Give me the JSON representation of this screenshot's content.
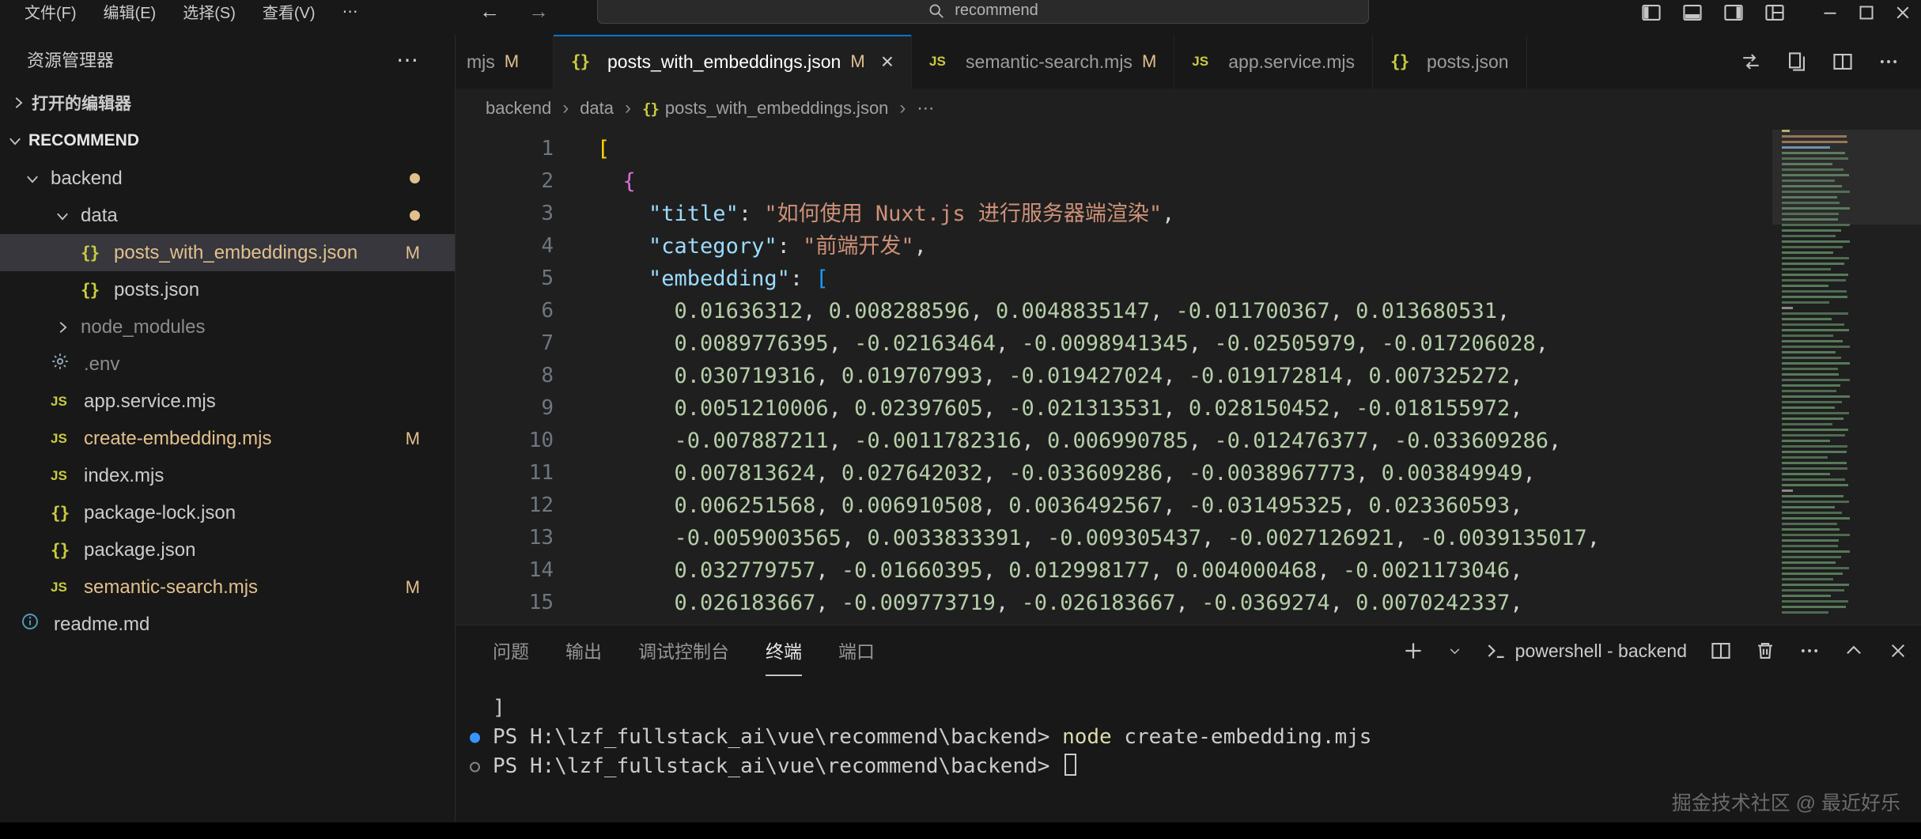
{
  "titlebar": {
    "menu_items": [
      "文件(F)",
      "编辑(E)",
      "选择(S)",
      "查看(V)",
      "⋯"
    ],
    "back_icon": "←",
    "forward_icon": "→",
    "search_value": "recommend",
    "layout_icons": [
      "toggle-primary-sidebar-icon",
      "toggle-panel-icon",
      "toggle-secondary-sidebar-icon",
      "customize-layout-icon"
    ],
    "window_controls": [
      "minimize-icon",
      "maximize-icon",
      "close-icon"
    ]
  },
  "sidebar": {
    "title": "资源管理器",
    "more_icon": "⋯",
    "open_editors_label": "打开的编辑器",
    "section_label": "RECOMMEND",
    "tree": [
      {
        "label": "backend",
        "type": "folder",
        "expanded": true,
        "indent": 0,
        "badge": "dot"
      },
      {
        "label": "data",
        "type": "folder",
        "expanded": true,
        "indent": 1,
        "badge": "dot"
      },
      {
        "label": "posts_with_embeddings.json",
        "type": "json",
        "indent": 2,
        "badge": "M",
        "selected": true,
        "modified": true
      },
      {
        "label": "posts.json",
        "type": "json",
        "indent": 2
      },
      {
        "label": "node_modules",
        "type": "folder",
        "expanded": false,
        "indent": 1,
        "dim": true
      },
      {
        "label": ".env",
        "type": "gear",
        "indent": 1,
        "dim": true
      },
      {
        "label": "app.service.mjs",
        "type": "js",
        "indent": 1
      },
      {
        "label": "create-embedding.mjs",
        "type": "js",
        "indent": 1,
        "badge": "M",
        "modified": true
      },
      {
        "label": "index.mjs",
        "type": "js",
        "indent": 1
      },
      {
        "label": "package-lock.json",
        "type": "json",
        "indent": 1
      },
      {
        "label": "package.json",
        "type": "json",
        "indent": 1
      },
      {
        "label": "semantic-search.mjs",
        "type": "js",
        "indent": 1,
        "badge": "M",
        "modified": true
      },
      {
        "label": "readme.md",
        "type": "info",
        "indent": 0
      }
    ]
  },
  "tabs": [
    {
      "label": "mjs",
      "icon": null,
      "badge": "M",
      "partial": true
    },
    {
      "label": "posts_with_embeddings.json",
      "icon": "json",
      "badge": "M",
      "active": true,
      "close": true
    },
    {
      "label": "semantic-search.mjs",
      "icon": "js",
      "badge": "M"
    },
    {
      "label": "app.service.mjs",
      "icon": "js"
    },
    {
      "label": "posts.json",
      "icon": "json"
    }
  ],
  "editor_actions": [
    "compare-changes-icon",
    "open-changes-icon",
    "split-editor-icon",
    "more-actions-icon"
  ],
  "breadcrumb": [
    {
      "label": "backend"
    },
    {
      "label": "data"
    },
    {
      "label": "posts_with_embeddings.json",
      "icon": "json"
    },
    {
      "label": "⋯"
    }
  ],
  "editor": {
    "lines": [
      {
        "n": 1,
        "tokens": [
          {
            "t": "[",
            "c": "b1"
          }
        ]
      },
      {
        "n": 2,
        "tokens": [
          {
            "t": "  ",
            "c": "p"
          },
          {
            "t": "{",
            "c": "b2"
          }
        ]
      },
      {
        "n": 3,
        "tokens": [
          {
            "t": "    ",
            "c": "p"
          },
          {
            "t": "\"title\"",
            "c": "k"
          },
          {
            "t": ": ",
            "c": "p"
          },
          {
            "t": "\"如何使用 Nuxt.js 进行服务器端渲染\"",
            "c": "s"
          },
          {
            "t": ",",
            "c": "p"
          }
        ]
      },
      {
        "n": 4,
        "tokens": [
          {
            "t": "    ",
            "c": "p"
          },
          {
            "t": "\"category\"",
            "c": "k"
          },
          {
            "t": ": ",
            "c": "p"
          },
          {
            "t": "\"前端开发\"",
            "c": "s"
          },
          {
            "t": ",",
            "c": "p"
          }
        ]
      },
      {
        "n": 5,
        "tokens": [
          {
            "t": "    ",
            "c": "p"
          },
          {
            "t": "\"embedding\"",
            "c": "k"
          },
          {
            "t": ": ",
            "c": "p"
          },
          {
            "t": "[",
            "c": "b3"
          }
        ]
      },
      {
        "n": 6,
        "indent": "      ",
        "numbers": [
          "0.01636312",
          "0.008288596",
          "0.0048835147",
          "-0.011700367",
          "0.013680531"
        ]
      },
      {
        "n": 7,
        "indent": "      ",
        "numbers": [
          "0.0089776395",
          "-0.02163464",
          "-0.0098941345",
          "-0.02505979",
          "-0.017206028"
        ]
      },
      {
        "n": 8,
        "indent": "      ",
        "numbers": [
          "0.030719316",
          "0.019707993",
          "-0.019427024",
          "-0.019172814",
          "0.007325272"
        ]
      },
      {
        "n": 9,
        "indent": "      ",
        "numbers": [
          "0.0051210006",
          "0.02397605",
          "-0.021313531",
          "0.028150452",
          "-0.018155972"
        ]
      },
      {
        "n": 10,
        "indent": "      ",
        "numbers": [
          "-0.007887211",
          "-0.0011782316",
          "0.006990785",
          "-0.012476377",
          "-0.033609286"
        ]
      },
      {
        "n": 11,
        "indent": "      ",
        "numbers": [
          "0.007813624",
          "0.027642032",
          "-0.033609286",
          "-0.0038967773",
          "0.003849949"
        ]
      },
      {
        "n": 12,
        "indent": "      ",
        "numbers": [
          "0.006251568",
          "0.006910508",
          "0.0036492567",
          "-0.031495325",
          "0.023360593"
        ]
      },
      {
        "n": 13,
        "indent": "      ",
        "numbers": [
          "-0.0059003565",
          "0.0033833391",
          "-0.009305437",
          "-0.0027126921",
          "-0.0039135017"
        ]
      },
      {
        "n": 14,
        "indent": "      ",
        "numbers": [
          "0.032779757",
          "-0.01660395",
          "0.012998177",
          "0.004000468",
          "-0.0021173046"
        ]
      },
      {
        "n": 15,
        "indent": "      ",
        "numbers": [
          "0.026183667",
          "-0.009773719",
          "-0.026183667",
          "-0.0369274",
          "0.0070242337"
        ]
      }
    ]
  },
  "panel": {
    "tabs": [
      {
        "label": "问题"
      },
      {
        "label": "输出"
      },
      {
        "label": "调试控制台"
      },
      {
        "label": "终端",
        "active": true
      },
      {
        "label": "端口"
      }
    ],
    "terminal_title": "powershell - backend",
    "actions": [
      "new-terminal-icon",
      "terminal-dropdown-icon",
      "terminal-instance",
      "split-terminal-icon",
      "kill-terminal-icon",
      "more-actions-icon",
      "maximize-panel-icon",
      "close-panel-icon"
    ],
    "terminal": [
      {
        "text": "]"
      },
      {
        "marker": "filled",
        "prompt": "PS H:\\lzf_fullstack_ai\\vue\\recommend\\backend>",
        "command": "node",
        "args": "create-embedding.mjs"
      },
      {
        "marker": "hollow",
        "prompt": "PS H:\\lzf_fullstack_ai\\vue\\recommend\\backend>",
        "cursor": true
      }
    ]
  },
  "watermark": "掘金技术社区 @ 最近好乐",
  "colors": {
    "accent": "#0078d4",
    "git_modified": "#e2c08d",
    "json_key": "#9cdcfe",
    "json_string": "#ce9178",
    "json_number": "#b5cea8",
    "bracket_level1": "#ffd700",
    "bracket_level2": "#da70d6",
    "bracket_level3": "#179fff",
    "terminal_command": "#dcdcaa",
    "terminal_marker": "#3794ff",
    "file_icon_yellow": "#cbcb41"
  }
}
